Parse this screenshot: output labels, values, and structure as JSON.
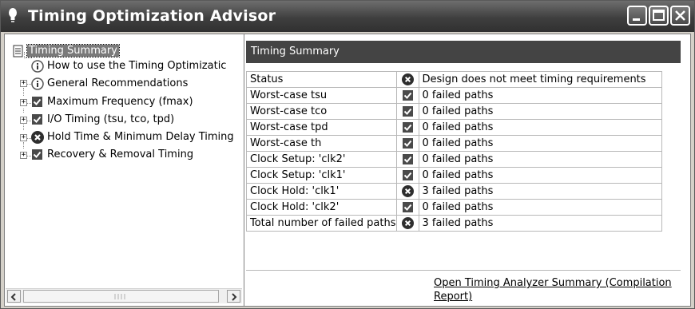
{
  "window": {
    "title": "Timing Optimization Advisor",
    "icon": "lightbulb-icon",
    "controls": [
      "minimize-icon",
      "maximize-icon",
      "close-icon"
    ]
  },
  "tree": {
    "items": [
      {
        "label": "Timing Summary",
        "icon": "summary-page-icon",
        "expander": null,
        "selected": true
      },
      {
        "label": "How to use the Timing Optimizatic",
        "icon": "info-icon",
        "expander": null
      },
      {
        "label": "General Recommendations",
        "icon": "info-icon",
        "expander": "+"
      },
      {
        "label": "Maximum Frequency (fmax)",
        "icon": "check-icon",
        "expander": "+"
      },
      {
        "label": "I/O Timing (tsu, tco, tpd)",
        "icon": "check-icon",
        "expander": "+"
      },
      {
        "label": "Hold Time & Minimum Delay Timing",
        "icon": "fail-x-icon",
        "expander": "+"
      },
      {
        "label": "Recovery & Removal Timing",
        "icon": "check-icon",
        "expander": "+"
      }
    ]
  },
  "panel": {
    "header": "Timing Summary",
    "rows": [
      {
        "name": "Status",
        "status": "fail",
        "result": "Design does not meet timing requirements"
      },
      {
        "name": "Worst-case tsu",
        "status": "pass",
        "result": "0  failed paths"
      },
      {
        "name": "Worst-case tco",
        "status": "pass",
        "result": "0  failed paths"
      },
      {
        "name": "Worst-case tpd",
        "status": "pass",
        "result": "0  failed paths"
      },
      {
        "name": "Worst-case th",
        "status": "pass",
        "result": "0  failed paths"
      },
      {
        "name": "Clock Setup: 'clk2'",
        "status": "pass",
        "result": "0  failed paths"
      },
      {
        "name": "Clock Setup: 'clk1'",
        "status": "pass",
        "result": "0  failed paths"
      },
      {
        "name": "Clock Hold: 'clk1'",
        "status": "fail",
        "result": "3  failed paths"
      },
      {
        "name": "Clock Hold: 'clk2'",
        "status": "pass",
        "result": "0  failed paths"
      },
      {
        "name": "Total number of failed paths",
        "status": "fail",
        "result": "3  failed paths"
      }
    ],
    "link": "Open Timing Analyzer Summary (Compilation Report)"
  },
  "colors": {
    "titlebar": "#3f3f3f",
    "panel_header": "#444444",
    "fail_icon": "#2e2e2e",
    "check_icon": "#4a4a4a"
  }
}
